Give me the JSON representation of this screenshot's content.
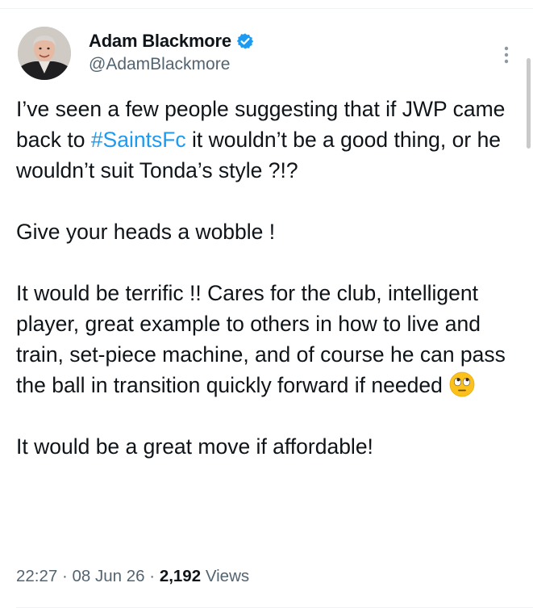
{
  "author": {
    "display_name": "Adam Blackmore",
    "handle": "@AdamBlackmore",
    "verified": true,
    "verified_color": "#1d9bf0",
    "avatar_icon": "profile-photo"
  },
  "tweet": {
    "para1_a": "I’ve seen a few people suggesting that if JWP came back to ",
    "hashtag": "#SaintsFc",
    "para1_b": " it wouldn’t be a good thing, or he wouldn’t suit Tonda’s style ?!?",
    "para2": "Give your heads a wobble !",
    "para3": "It would be terrific !! Cares for the club, intelligent player, great example to others in how to live and train, set-piece machine, and of course he can pass the ball in transition quickly forward if needed",
    "emoji": "face-with-rolling-eyes",
    "para4": "It would be a great move if affordable!"
  },
  "meta": {
    "time": "22:27",
    "sep1": " · ",
    "date": "08 Jun 26",
    "sep2": " · ",
    "views_count": "2,192",
    "views_label": " Views"
  },
  "colors": {
    "text": "#0f1419",
    "secondary": "#536471",
    "accent": "#1d9bf0"
  },
  "icons": {
    "more": "more-vertical-icon"
  }
}
